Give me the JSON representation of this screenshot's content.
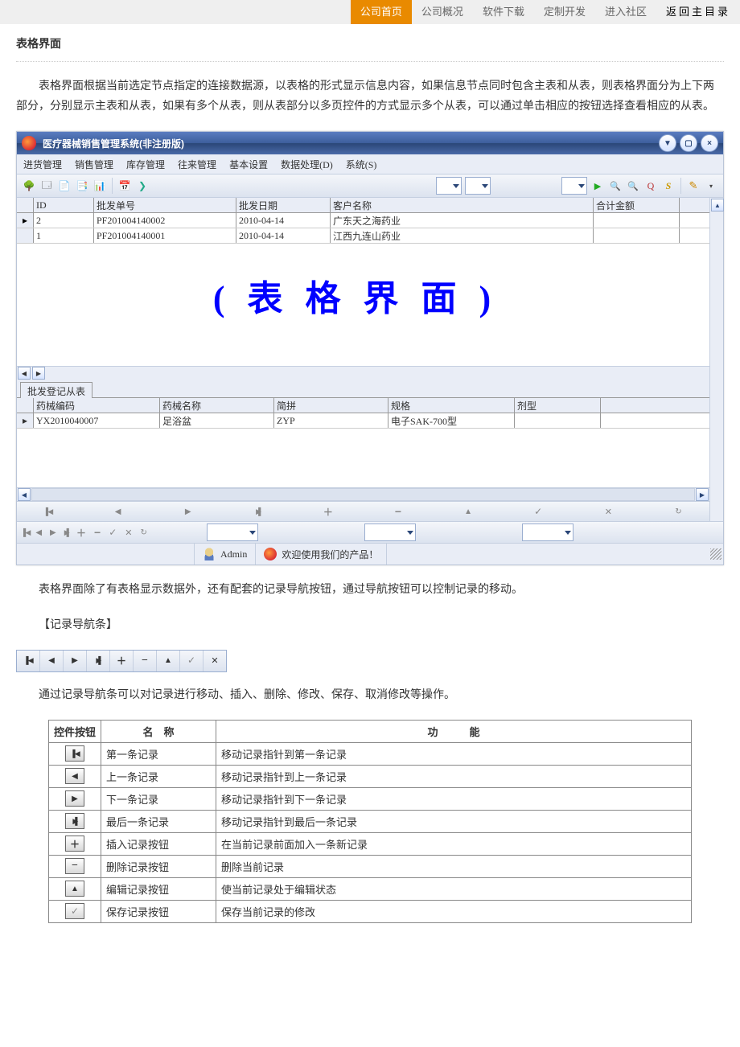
{
  "nav": {
    "items": [
      "公司首页",
      "公司概况",
      "软件下载",
      "定制开发",
      "进入社区"
    ],
    "back": "返回主目录"
  },
  "page": {
    "title": "表格界面",
    "intro": "表格界面根据当前选定节点指定的连接数据源，以表格的形式显示信息内容，如果信息节点同时包含主表和从表，则表格界面分为上下两部分，分别显示主表和从表，如果有多个从表，则从表部分以多页控件的方式显示多个从表，可以通过单击相应的按钮选择查看相应的从表。",
    "after": "表格界面除了有表格显示数据外，还有配套的记录导航按钮，通过导航按钮可以控制记录的移动。",
    "section_nav": "【记录导航条】",
    "nav_desc": "通过记录导航条可以对记录进行移动、插入、删除、修改、保存、取消修改等操作。"
  },
  "app": {
    "title": "医疗器械销售管理系统(非注册版)",
    "menu": [
      "进货管理",
      "销售管理",
      "库存管理",
      "往来管理",
      "基本设置",
      "数据处理(D)",
      "系统(S)"
    ],
    "watermark": "(表格界面)",
    "master": {
      "headers": [
        "ID",
        "批发单号",
        "批发日期",
        "客户名称",
        "合计金额"
      ],
      "rows": [
        {
          "id": "2",
          "code": "PF201004140002",
          "date": "2010-04-14",
          "name": "广东天之海药业",
          "amt": "",
          "sel": true
        },
        {
          "id": "1",
          "code": "PF201004140001",
          "date": "2010-04-14",
          "name": "江西九连山药业",
          "amt": "",
          "sel": false
        }
      ]
    },
    "detail": {
      "tab": "批发登记从表",
      "headers": [
        "药械编码",
        "药械名称",
        "简拼",
        "规格",
        "剂型"
      ],
      "rows": [
        {
          "code": "YX2010040007",
          "name": "足浴盆",
          "py": "ZYP",
          "spec": "电子SAK-700型",
          "form": "",
          "sel": true
        }
      ]
    },
    "status": {
      "user": "Admin",
      "welcome": "欢迎使用我们的产品！"
    }
  },
  "ref": {
    "th": [
      "控件按钮",
      "名　称",
      "功　　　能"
    ],
    "rows": [
      {
        "icon": "i-first",
        "name": "第一条记录",
        "func": "移动记录指针到第一条记录"
      },
      {
        "icon": "i-prev",
        "name": "上一条记录",
        "func": "移动记录指针到上一条记录"
      },
      {
        "icon": "i-next",
        "name": "下一条记录",
        "func": "移动记录指针到下一条记录"
      },
      {
        "icon": "i-last",
        "name": "最后一条记录",
        "func": "移动记录指针到最后一条记录"
      },
      {
        "icon": "i-plus",
        "name": "插入记录按钮",
        "func": "在当前记录前面加入一条新记录"
      },
      {
        "icon": "i-minus",
        "name": "删除记录按钮",
        "func": "删除当前记录"
      },
      {
        "icon": "i-edit",
        "name": "编辑记录按钮",
        "func": "使当前记录处于编辑状态"
      },
      {
        "icon": "i-check",
        "name": "保存记录按钮",
        "func": "保存当前记录的修改"
      }
    ]
  }
}
